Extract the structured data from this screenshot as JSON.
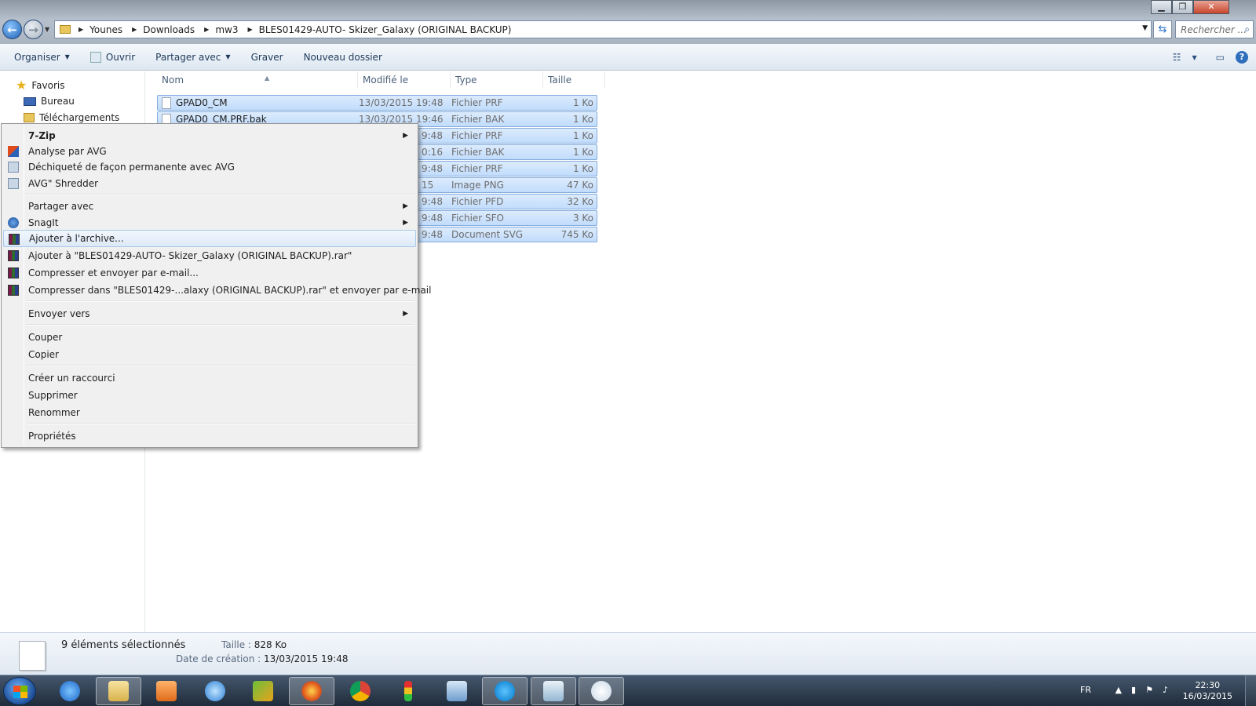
{
  "window": {
    "controls": {
      "minimize": "▁",
      "maximize": "❐",
      "close": "✕"
    }
  },
  "address": {
    "crumbs": [
      "Younes",
      "Downloads",
      "mw3",
      "BLES01429-AUTO- Skizer_Galaxy (ORIGINAL BACKUP)"
    ],
    "search_placeholder": "Rechercher ..."
  },
  "toolbar": {
    "organiser": "Organiser",
    "ouvrir": "Ouvrir",
    "partager": "Partager avec",
    "graver": "Graver",
    "nouveau_dossier": "Nouveau dossier"
  },
  "nav": {
    "favoris": "Favoris",
    "bureau": "Bureau",
    "telechargements": "Téléchargements"
  },
  "columns": {
    "nom": "Nom",
    "modifie": "Modifié le",
    "type": "Type",
    "taille": "Taille"
  },
  "files": [
    {
      "name": "GPAD0_CM",
      "modified": "13/03/2015 19:48",
      "type": "Fichier PRF",
      "size": "1 Ko"
    },
    {
      "name": "GPAD0_CM.PRF.bak",
      "modified": "13/03/2015 19:46",
      "type": "Fichier BAK",
      "size": "1 Ko"
    },
    {
      "name": "",
      "modified": "9:48",
      "type": "Fichier PRF",
      "size": "1 Ko"
    },
    {
      "name": "",
      "modified": "0:16",
      "type": "Fichier BAK",
      "size": "1 Ko"
    },
    {
      "name": "",
      "modified": "9:48",
      "type": "Fichier PRF",
      "size": "1 Ko"
    },
    {
      "name": "",
      "modified": "15",
      "type": "Image PNG",
      "size": "47 Ko"
    },
    {
      "name": "",
      "modified": "9:48",
      "type": "Fichier PFD",
      "size": "32 Ko"
    },
    {
      "name": "",
      "modified": "9:48",
      "type": "Fichier SFO",
      "size": "3 Ko"
    },
    {
      "name": "",
      "modified": "9:48",
      "type": "Document SVG",
      "size": "745 Ko"
    }
  ],
  "context_menu": {
    "zip": "7-Zip",
    "avg_scan": "Analyse par AVG",
    "avg_shred_perm": "Déchiqueté de façon permanente avec AVG",
    "avg_shredder": "AVG\" Shredder",
    "share": "Partager avec",
    "snagit": "SnagIt",
    "add_archive": "Ajouter à l'archive...",
    "add_rar": "Ajouter à \"BLES01429-AUTO- Skizer_Galaxy (ORIGINAL BACKUP).rar\"",
    "compress_email": "Compresser et envoyer par e-mail...",
    "compress_rar_email": "Compresser dans \"BLES01429-...alaxy (ORIGINAL BACKUP).rar\" et envoyer par e-mail",
    "send_to": "Envoyer vers",
    "cut": "Couper",
    "copy": "Copier",
    "shortcut": "Créer un raccourci",
    "delete": "Supprimer",
    "rename": "Renommer",
    "properties": "Propriétés"
  },
  "status": {
    "selected": "9 éléments sélectionnés",
    "size_label": "Taille :",
    "size_value": "828 Ko",
    "created_label": "Date de création :",
    "created_value": "13/03/2015 19:48"
  },
  "taskbar": {
    "lang": "FR",
    "time": "22:30",
    "date": "16/03/2015"
  }
}
